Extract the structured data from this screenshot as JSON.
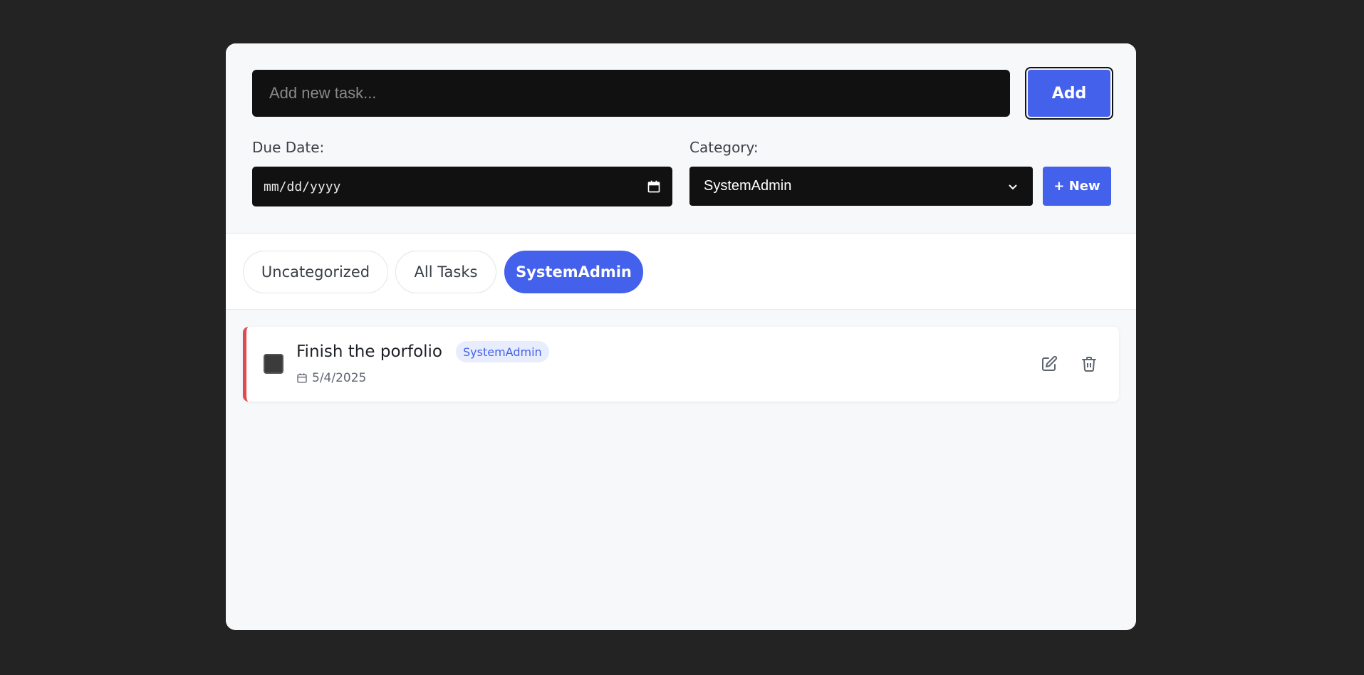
{
  "form": {
    "task_placeholder": "Add new task...",
    "add_label": "Add",
    "due_date_label": "Due Date:",
    "date_placeholder": "mm/dd/yyyy",
    "category_label": "Category:",
    "selected_category": "SystemAdmin",
    "new_category_label": "+ New"
  },
  "tabs": [
    {
      "label": "Uncategorized",
      "active": false
    },
    {
      "label": "All Tasks",
      "active": false
    },
    {
      "label": "SystemAdmin",
      "active": true
    }
  ],
  "tasks": [
    {
      "title": "Finish the porfolio",
      "category": "SystemAdmin",
      "due_date": "5/4/2025",
      "completed": false,
      "priority_color": "#e5484d"
    }
  ],
  "colors": {
    "accent": "#4461ec",
    "background": "#232323",
    "card": "#f7f8fa"
  },
  "icons": {
    "date_field": "calendar-icon",
    "select_arrow": "chevron-down-icon",
    "due": "calendar-icon",
    "edit": "edit-icon",
    "delete": "trash-icon"
  }
}
